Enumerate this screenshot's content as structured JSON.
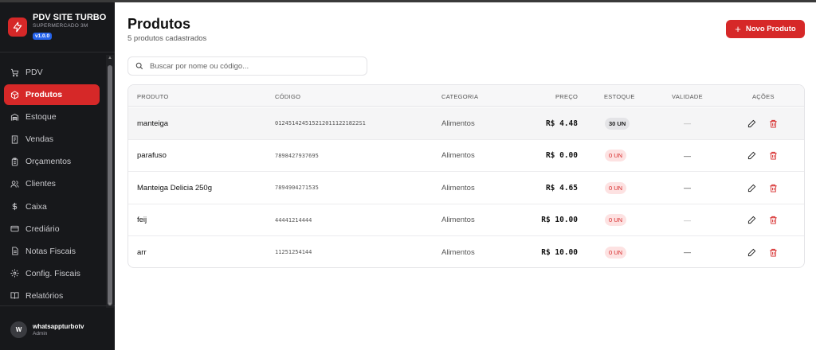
{
  "app": {
    "title": "PDV SITE TURBO",
    "subtitle": "SUPERMERCADO 3M",
    "version": "v1.0.0",
    "accent_color": "#d62828"
  },
  "sidebar": {
    "items": [
      {
        "label": "PDV",
        "icon": "cart-icon",
        "active": false
      },
      {
        "label": "Produtos",
        "icon": "box-icon",
        "active": true
      },
      {
        "label": "Estoque",
        "icon": "warehouse-icon",
        "active": false
      },
      {
        "label": "Vendas",
        "icon": "receipt-icon",
        "active": false
      },
      {
        "label": "Orçamentos",
        "icon": "clipboard-icon",
        "active": false
      },
      {
        "label": "Clientes",
        "icon": "users-icon",
        "active": false
      },
      {
        "label": "Caixa",
        "icon": "dollar-icon",
        "active": false
      },
      {
        "label": "Crediário",
        "icon": "credit-card-icon",
        "active": false
      },
      {
        "label": "Notas Fiscais",
        "icon": "file-icon",
        "active": false
      },
      {
        "label": "Config. Fiscais",
        "icon": "gear-icon",
        "active": false
      },
      {
        "label": "Relatórios",
        "icon": "book-icon",
        "active": false
      }
    ]
  },
  "user": {
    "initial": "W",
    "name": "whatsappturbotv",
    "role": "Admin"
  },
  "main": {
    "title": "Produtos",
    "subtitle": "5 produtos cadastrados",
    "new_button": "Novo Produto",
    "search_placeholder": "Buscar por nome ou código..."
  },
  "table": {
    "headers": {
      "produto": "PRODUTO",
      "codigo": "CÓDIGO",
      "categoria": "CATEGORIA",
      "preco": "PREÇO",
      "estoque": "ESTOQUE",
      "validade": "VALIDADE",
      "acoes": "AÇÕES"
    },
    "rows": [
      {
        "produto": "manteiga",
        "codigo": "0124514245152120111221822S1",
        "categoria": "Alimentos",
        "preco": "R$ 4.48",
        "estoque": "30 UN",
        "estoque_status": "ok",
        "validade": "—"
      },
      {
        "produto": "parafuso",
        "codigo": "7898427937695",
        "categoria": "Alimentos",
        "preco": "R$ 0.00",
        "estoque": "0 UN",
        "estoque_status": "low",
        "validade": "—"
      },
      {
        "produto": "Manteiga Delicia 250g",
        "codigo": "7894904271535",
        "categoria": "Alimentos",
        "preco": "R$ 4.65",
        "estoque": "0 UN",
        "estoque_status": "low",
        "validade": "—"
      },
      {
        "produto": "feij",
        "codigo": "44441214444",
        "categoria": "Alimentos",
        "preco": "R$ 10.00",
        "estoque": "0 UN",
        "estoque_status": "low",
        "validade": "—"
      },
      {
        "produto": "arr",
        "codigo": "11251254144",
        "categoria": "Alimentos",
        "preco": "R$ 10.00",
        "estoque": "0 UN",
        "estoque_status": "low",
        "validade": "—"
      }
    ]
  }
}
